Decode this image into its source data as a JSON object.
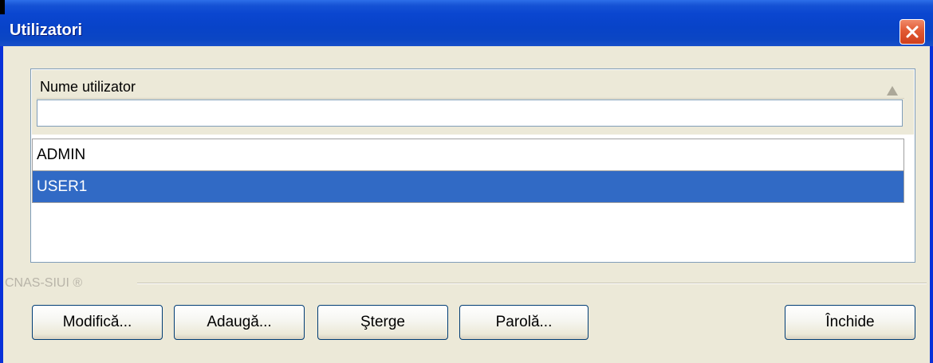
{
  "window": {
    "title": "Utilizatori",
    "close_icon": "close-x-icon"
  },
  "grid": {
    "column_header": "Nume utilizator",
    "sort_icon": "sort-ascending-icon",
    "filter_value": "",
    "rows": [
      {
        "name": "ADMIN",
        "selected": false
      },
      {
        "name": "USER1",
        "selected": true
      }
    ]
  },
  "footer": {
    "group_label": "CNAS-SIUI ®"
  },
  "buttons": {
    "modify_label": "Modifică...",
    "add_label": "Adaugă...",
    "delete_label": "Şterge",
    "password_label": "Parolă...",
    "close_label": "Închide"
  },
  "colors": {
    "titlebar": "#0a46d0",
    "selection": "#316ac5",
    "dialog_background": "#ece9d8",
    "close_button": "#e25a33"
  }
}
